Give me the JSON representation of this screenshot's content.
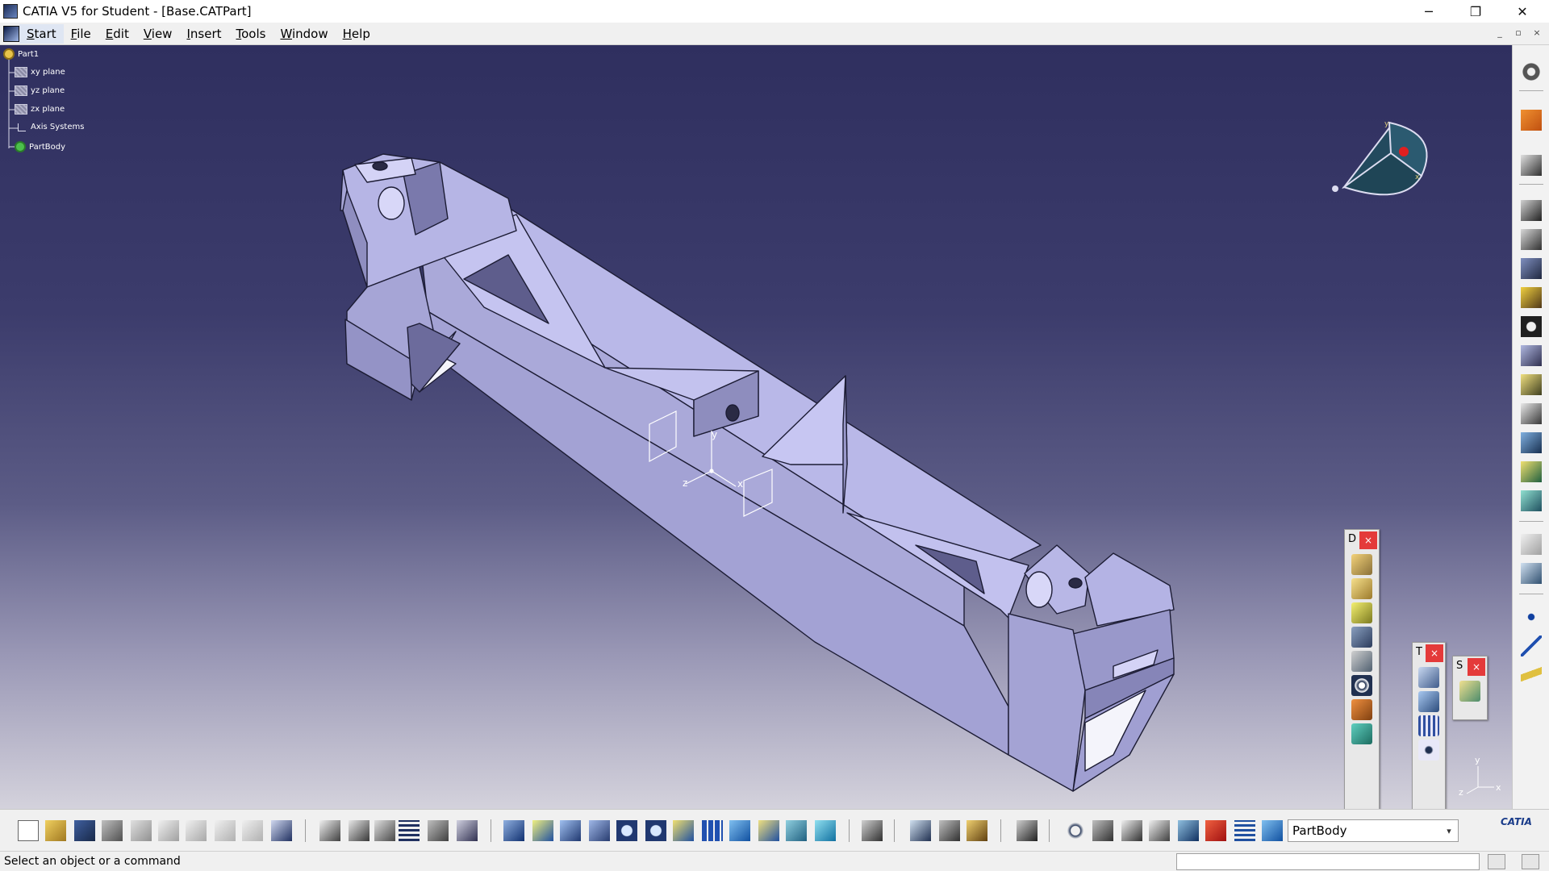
{
  "window": {
    "title": "CATIA V5 for Student - [Base.CATPart]",
    "minimize_glyph": "─",
    "restore_glyph": "❐",
    "close_glyph": "✕"
  },
  "menubar": {
    "items": [
      {
        "label": "Start",
        "underline": "S",
        "rest": "tart"
      },
      {
        "label": "File",
        "underline": "F",
        "rest": "ile"
      },
      {
        "label": "Edit",
        "underline": "E",
        "rest": "dit"
      },
      {
        "label": "View",
        "underline": "V",
        "rest": "iew"
      },
      {
        "label": "Insert",
        "underline": "I",
        "rest": "nsert"
      },
      {
        "label": "Tools",
        "underline": "T",
        "rest": "ools"
      },
      {
        "label": "Window",
        "underline": "W",
        "rest": "indow"
      },
      {
        "label": "Help",
        "underline": "H",
        "rest": "elp"
      }
    ],
    "doc_minimize": "_",
    "doc_restore": "▫",
    "doc_close": "×"
  },
  "tree": {
    "root": "Part1",
    "items": [
      "xy plane",
      "yz plane",
      "zx plane",
      "Axis Systems",
      "PartBody"
    ]
  },
  "compass": {
    "x_label": "x",
    "y_label": "y",
    "z_label": "z"
  },
  "axis_triad": {
    "x_label": "x",
    "y_label": "y",
    "z_label": "z"
  },
  "floating_toolbars": [
    {
      "letter": "D",
      "close": "×"
    },
    {
      "letter": "T",
      "close": "×"
    },
    {
      "letter": "S",
      "close": "×"
    }
  ],
  "workbench_select": {
    "value": "PartBody",
    "arrow": "▾"
  },
  "status": {
    "message": "Select an object or a command",
    "power_input_value": ""
  },
  "catia_logo": "CATIA",
  "colors": {
    "viewport_top": "#2f2f5f",
    "viewport_bottom": "#d4d2dc",
    "part_face_light": "#c9c8ee",
    "part_face_mid": "#a9a8d8",
    "part_face_dark": "#6f6e9e",
    "close_red": "#e43a3a"
  }
}
